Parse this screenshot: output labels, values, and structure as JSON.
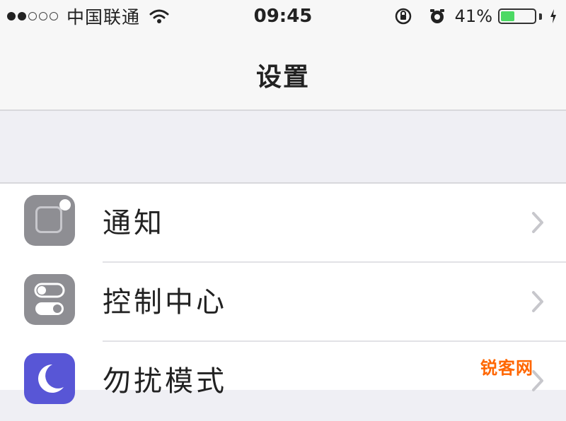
{
  "status_bar": {
    "signal_dots_filled": 2,
    "signal_dots_total": 5,
    "carrier": "中国联通",
    "time": "09:45",
    "battery_percent": "41%",
    "battery_level": 0.41,
    "battery_color": "#4cd964"
  },
  "nav": {
    "title": "设置"
  },
  "settings": {
    "items": [
      {
        "label": "通知",
        "icon": "notifications-icon",
        "icon_color": "#8e8e93"
      },
      {
        "label": "控制中心",
        "icon": "control-center-icon",
        "icon_color": "#8e8e93"
      },
      {
        "label": "勿扰模式",
        "icon": "do-not-disturb-icon",
        "icon_color": "#5856d6"
      }
    ]
  },
  "watermark": {
    "text": "锐客网"
  }
}
